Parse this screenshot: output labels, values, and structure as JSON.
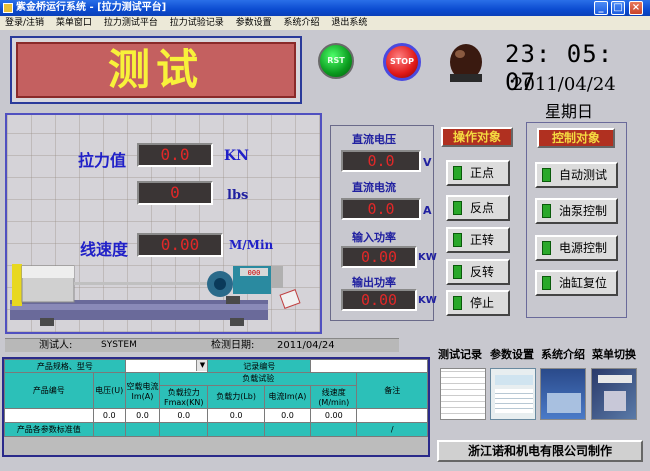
{
  "window": {
    "title": "紫金桥运行系统 - [拉力测试平台]",
    "buttons": [
      "_",
      "□",
      "×"
    ]
  },
  "menu": [
    "登录/注销",
    "菜单窗口",
    "拉力测试平台",
    "拉力试验记录",
    "参数设置",
    "系统介绍",
    "退出系统"
  ],
  "header": {
    "big_title": "测试",
    "rst_label": "RST",
    "stop_label": "STOP",
    "time": "23: 05: 07",
    "date": "2011/04/24",
    "weekday": "星期日"
  },
  "measurements": {
    "tension_label": "拉力值",
    "tension_value": "0.0",
    "tension_unit": "KN",
    "lbs_value": "0",
    "lbs_unit": "lbs",
    "speed_label": "线速度",
    "speed_value": "0.00",
    "speed_unit": "M/Min"
  },
  "electric": {
    "dc_voltage_label": "直流电压",
    "dc_voltage_value": "0.0",
    "dc_voltage_unit": "V",
    "dc_current_label": "直流电流",
    "dc_current_value": "0.0",
    "dc_current_unit": "A",
    "input_power_label": "输入功率",
    "input_power_value": "0.00",
    "input_power_unit": "KW",
    "output_power_label": "输出功率",
    "output_power_value": "0.00",
    "output_power_unit": "KW"
  },
  "operation": {
    "title": "操作对象",
    "buttons": [
      "正点",
      "反点",
      "正转",
      "反转",
      "停止"
    ]
  },
  "control": {
    "title": "控制对象",
    "buttons": [
      "自动测试",
      "油泵控制",
      "电源控制",
      "油缸复位"
    ]
  },
  "machine": {
    "display_value": "000"
  },
  "info": {
    "tester_label": "测试人:",
    "tester_value": "SYSTEM",
    "date_label": "检测日期:",
    "date_value": "2011/04/24"
  },
  "table": {
    "spec_label": "产品规格、型号",
    "record_label": "记录编号",
    "product_no": "产品编号",
    "voltage": "电压(U)",
    "no_load_current": "空载电流Im(A)",
    "load_test": "负载试验",
    "load_tension": "负载拉力Fmax(KN)",
    "load_force": "负载力(Lb)",
    "current": "电流Im(A)",
    "line_speed": "线速度(M/min)",
    "remark": "备注",
    "row_values": [
      "0.0",
      "0.0",
      "0.0",
      "0.0",
      "0.0",
      "0.00"
    ],
    "standard_label": "产品各参数标准值",
    "standard_remark": "/"
  },
  "nav": {
    "items": [
      "测试记录",
      "参数设置",
      "系统介绍",
      "菜单切换"
    ]
  },
  "footer": {
    "company": "浙江诺和机电有限公司制作"
  }
}
